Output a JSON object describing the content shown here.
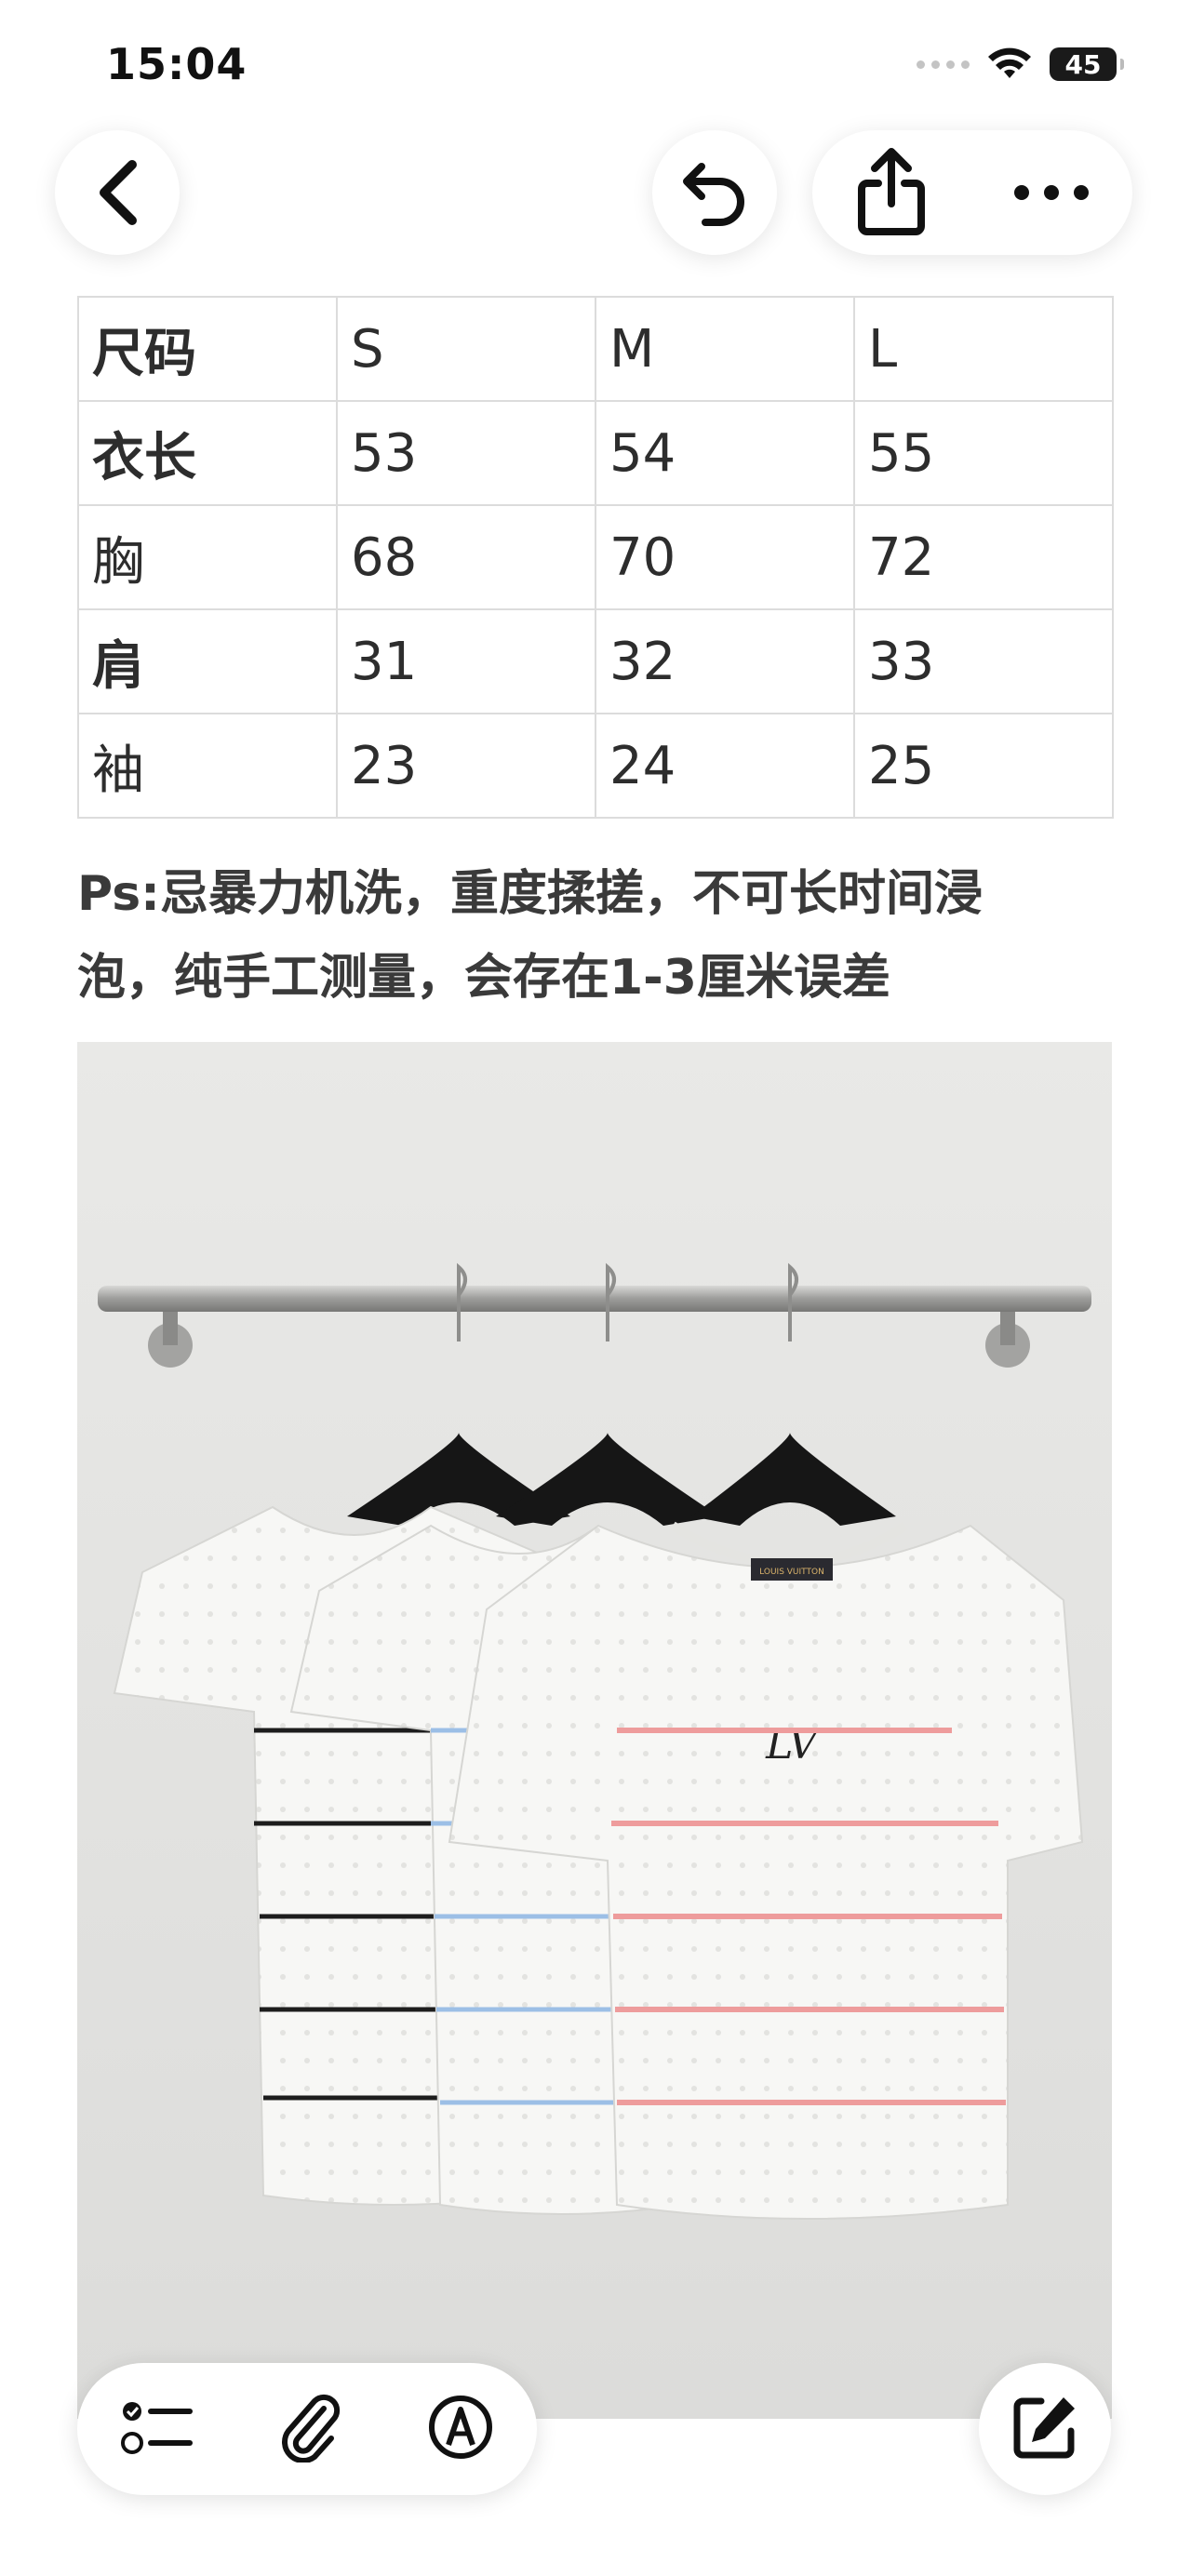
{
  "status_bar": {
    "time": "15:04",
    "battery": "45"
  },
  "toolbar": {
    "back_icon": "chevron-left-icon",
    "undo_icon": "undo-icon",
    "share_icon": "share-icon",
    "more_icon": "ellipsis-icon"
  },
  "size_table": {
    "rows": [
      [
        "尺码",
        "S",
        "M",
        "L"
      ],
      [
        "衣长",
        "53",
        "54",
        "55"
      ],
      [
        "胸",
        "68",
        "70",
        "72"
      ],
      [
        "肩",
        "31",
        "32",
        "33"
      ],
      [
        "袖",
        "23",
        "24",
        "25"
      ]
    ]
  },
  "note": {
    "line1": "Ps:忌暴力机洗，重度揉搓，不可长时间浸",
    "line2": "泡，纯手工测量，会存在1-3厘米误差"
  },
  "photo": {
    "label": "LOUIS VUITTON",
    "logo": "LV"
  },
  "bottom_toolbar": {
    "checklist_icon": "checklist-icon",
    "attach_icon": "paperclip-icon",
    "markup_icon": "markup-pen-icon",
    "compose_icon": "compose-icon"
  },
  "colors": {
    "stripe_black": "#1d1d1d",
    "stripe_blue": "#9cbfe6",
    "stripe_pink": "#ee9c9c"
  }
}
